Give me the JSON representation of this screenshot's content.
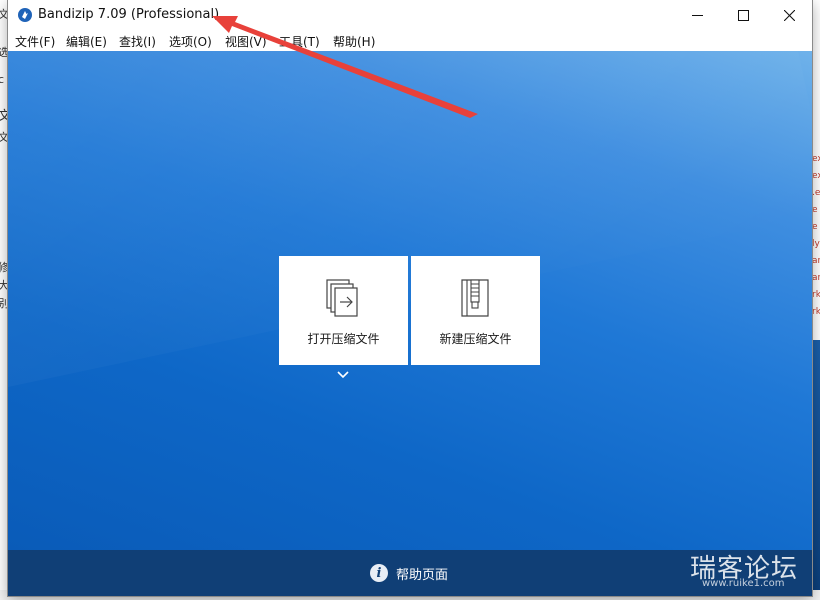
{
  "window": {
    "title": "Bandizip 7.09 (Professional)",
    "controls": {
      "minimize": "minimize-icon",
      "maximize": "maximize-icon",
      "close": "close-icon"
    }
  },
  "menu": [
    {
      "label": "文件(F)"
    },
    {
      "label": "编辑(E)"
    },
    {
      "label": "查找(I)"
    },
    {
      "label": "选项(O)"
    },
    {
      "label": "视图(V)"
    },
    {
      "label": "工具(T)"
    },
    {
      "label": "帮助(H)"
    }
  ],
  "tiles": {
    "open": {
      "label": "打开压缩文件",
      "icon": "open-archive-icon"
    },
    "new": {
      "label": "新建压缩文件",
      "icon": "zip-file-icon"
    }
  },
  "footer": {
    "help_label": "帮助页面",
    "icon": "info-icon"
  },
  "watermark": {
    "text": "瑞客论坛",
    "sub": "www.ruike1.com"
  },
  "background_fragments": {
    "left": [
      "文",
      "选",
      "c",
      "文",
      "文",
      "修",
      "大",
      "别"
    ],
    "right": [
      "ex",
      "ex",
      ".e",
      "e",
      "e",
      "ly",
      "an",
      "an",
      "rk",
      "rk"
    ]
  },
  "colors": {
    "accent_blue": "#1f78d6",
    "footer_bg": "#103f76",
    "arrow": "#e8413a"
  }
}
